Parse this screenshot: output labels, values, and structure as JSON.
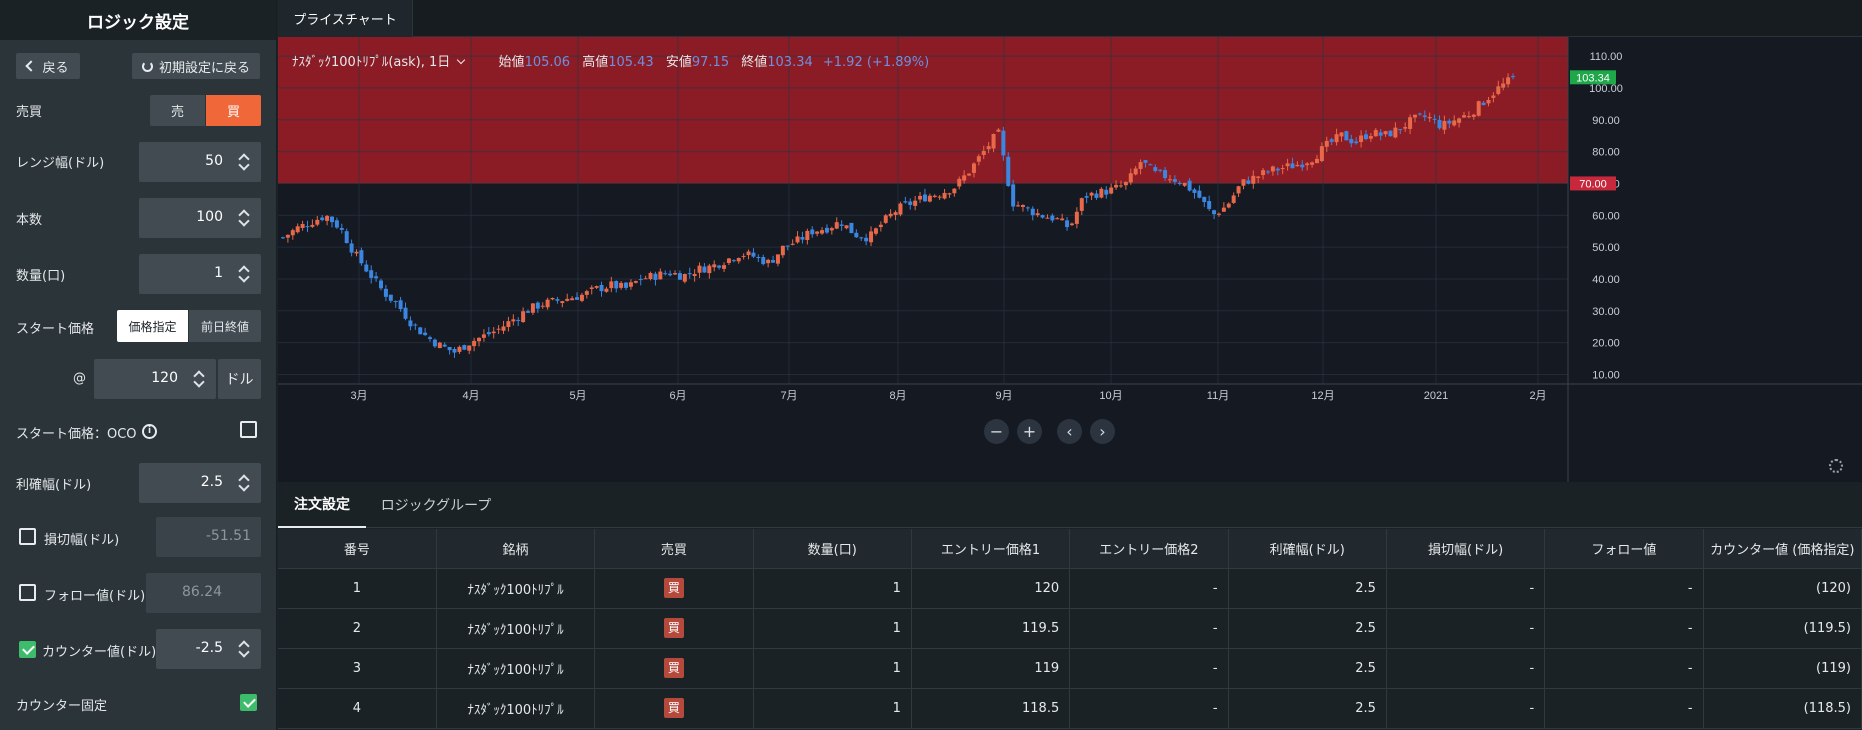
{
  "left": {
    "title": "ロジック設定",
    "back_label": "戻る",
    "reset_label": "初期設定に戻る",
    "side": {
      "label": "売買",
      "sell": "売",
      "buy": "買"
    },
    "range": {
      "label": "レンジ幅(ドル)",
      "value": "50"
    },
    "count": {
      "label": "本数",
      "value": "100"
    },
    "qty": {
      "label": "数量(口)",
      "value": "1"
    },
    "start": {
      "label": "スタート価格",
      "opt1": "価格指定",
      "opt2": "前日終値",
      "at": "@",
      "value": "120",
      "unit": "ドル"
    },
    "oco": {
      "label": "スタート価格：OCO"
    },
    "profit": {
      "label": "利確幅(ドル)",
      "value": "2.5"
    },
    "stop": {
      "label": "損切幅(ドル)",
      "value": "-51.51"
    },
    "follow": {
      "label": "フォロー値(ドル)",
      "value": "86.24"
    },
    "counter": {
      "label": "カウンター値(ドル)",
      "value": "-2.5"
    },
    "counter_fix": {
      "label": "カウンター固定"
    }
  },
  "tabs": {
    "price_chart": "プライスチャート"
  },
  "chart": {
    "symbol": "ﾅｽﾀﾞｯｸ100ﾄﾘﾌﾟﾙ(ask), 1日",
    "open_label": "始値",
    "open": "105.06",
    "high_label": "高値",
    "high": "105.43",
    "low_label": "安値",
    "low": "97.15",
    "close_label": "終値",
    "close": "103.34",
    "change": "+1.92 (+1.89%)",
    "price_tag": "103.34",
    "range_tag": "70.00",
    "colors": {
      "up": "#e8684a",
      "down": "#3b86e0",
      "band": "#8b1b25",
      "bg": "#141922"
    }
  },
  "chart_data": {
    "type": "candlestick",
    "y_ticks": [
      "110.00",
      "100.00",
      "90.00",
      "80.00",
      "70.00",
      "60.00",
      "50.00",
      "40.00",
      "30.00",
      "20.00",
      "10.00"
    ],
    "ylim": [
      7,
      116
    ],
    "x_ticks": [
      "3月",
      "4月",
      "5月",
      "6月",
      "7月",
      "8月",
      "9月",
      "10月",
      "11月",
      "12月",
      "2021",
      "2月"
    ],
    "last": 103.34,
    "range_upper": 70.0,
    "close_path": [
      53,
      56,
      58,
      60,
      56,
      48,
      42,
      36,
      32,
      26,
      22,
      19,
      17,
      20,
      22,
      24,
      27,
      30,
      32,
      33,
      34,
      35,
      37,
      38,
      37,
      40,
      41,
      42,
      41,
      43,
      44,
      46,
      48,
      47,
      45,
      50,
      52,
      55,
      56,
      58,
      54,
      53,
      58,
      62,
      64,
      66,
      67,
      69,
      74,
      80,
      86,
      64,
      62,
      60,
      59,
      56,
      66,
      67,
      68,
      70,
      77,
      73,
      72,
      70,
      66,
      60,
      63,
      70,
      72,
      74,
      75,
      76,
      78,
      82,
      85,
      83,
      86,
      85,
      87,
      90,
      91,
      88,
      90,
      92,
      96,
      100,
      103
    ]
  },
  "bottom_tabs": {
    "order": "注文設定",
    "group": "ロジックグループ"
  },
  "table": {
    "headers": [
      "番号",
      "銘柄",
      "売買",
      "数量(口)",
      "エントリー価格1",
      "エントリー価格2",
      "利確幅(ドル)",
      "損切幅(ドル)",
      "フォロー値",
      "カウンター値 (価格指定)"
    ],
    "rows": [
      {
        "no": "1",
        "sym": "ﾅｽﾀﾞｯｸ100ﾄﾘﾌﾟﾙ",
        "side": "買",
        "qty": "1",
        "e1": "120",
        "e2": "-",
        "tp": "2.5",
        "sl": "-",
        "fol": "-",
        "cnt": "(120)"
      },
      {
        "no": "2",
        "sym": "ﾅｽﾀﾞｯｸ100ﾄﾘﾌﾟﾙ",
        "side": "買",
        "qty": "1",
        "e1": "119.5",
        "e2": "-",
        "tp": "2.5",
        "sl": "-",
        "fol": "-",
        "cnt": "(119.5)"
      },
      {
        "no": "3",
        "sym": "ﾅｽﾀﾞｯｸ100ﾄﾘﾌﾟﾙ",
        "side": "買",
        "qty": "1",
        "e1": "119",
        "e2": "-",
        "tp": "2.5",
        "sl": "-",
        "fol": "-",
        "cnt": "(119)"
      },
      {
        "no": "4",
        "sym": "ﾅｽﾀﾞｯｸ100ﾄﾘﾌﾟﾙ",
        "side": "買",
        "qty": "1",
        "e1": "118.5",
        "e2": "-",
        "tp": "2.5",
        "sl": "-",
        "fol": "-",
        "cnt": "(118.5)"
      }
    ]
  }
}
